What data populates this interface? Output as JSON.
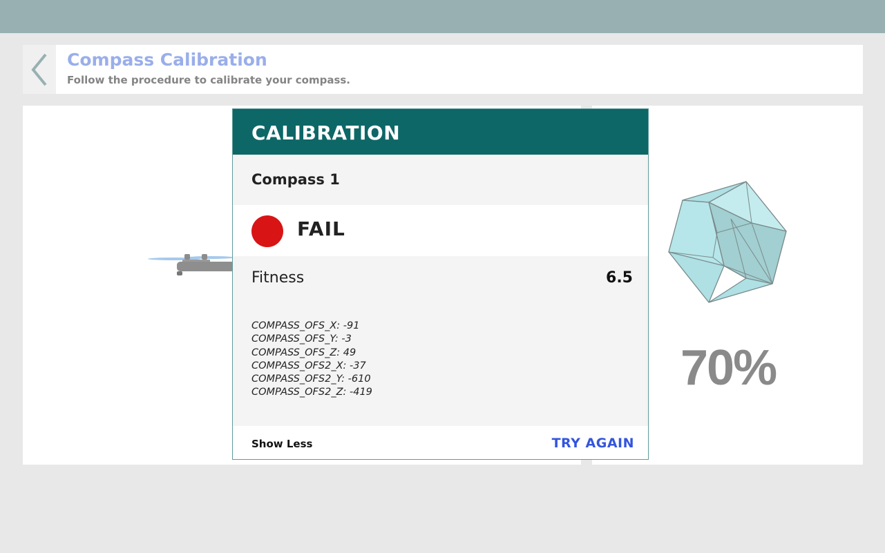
{
  "header": {
    "title": "Compass Calibration",
    "subtitle": "Follow the procedure to calibrate your compass."
  },
  "icons": {
    "back": "chevron-left-icon",
    "drone": "drone-icon",
    "polyhedron": "calibration-sphere-icon",
    "status": "status-dot"
  },
  "calibration_card": {
    "title": "CALIBRATION",
    "compass_name": "Compass 1",
    "status": "FAIL",
    "status_color": "#d81414",
    "fitness_label": "Fitness",
    "fitness_value": "6.5",
    "params": [
      "COMPASS_OFS_X: -91",
      "COMPASS_OFS_Y: -3",
      "COMPASS_OFS_Z: 49",
      "COMPASS_OFS2_X: -37",
      "COMPASS_OFS2_Y: -610",
      "COMPASS_OFS2_Z: -419"
    ],
    "show_less_label": "Show Less",
    "try_again_label": "TRY AGAIN"
  },
  "progress": {
    "value": 0.7,
    "label": "70%"
  },
  "colors": {
    "topbar": "#98b0b2",
    "card_header": "#0e6767",
    "title": "#9aaeea",
    "accent": "#3355dd"
  }
}
